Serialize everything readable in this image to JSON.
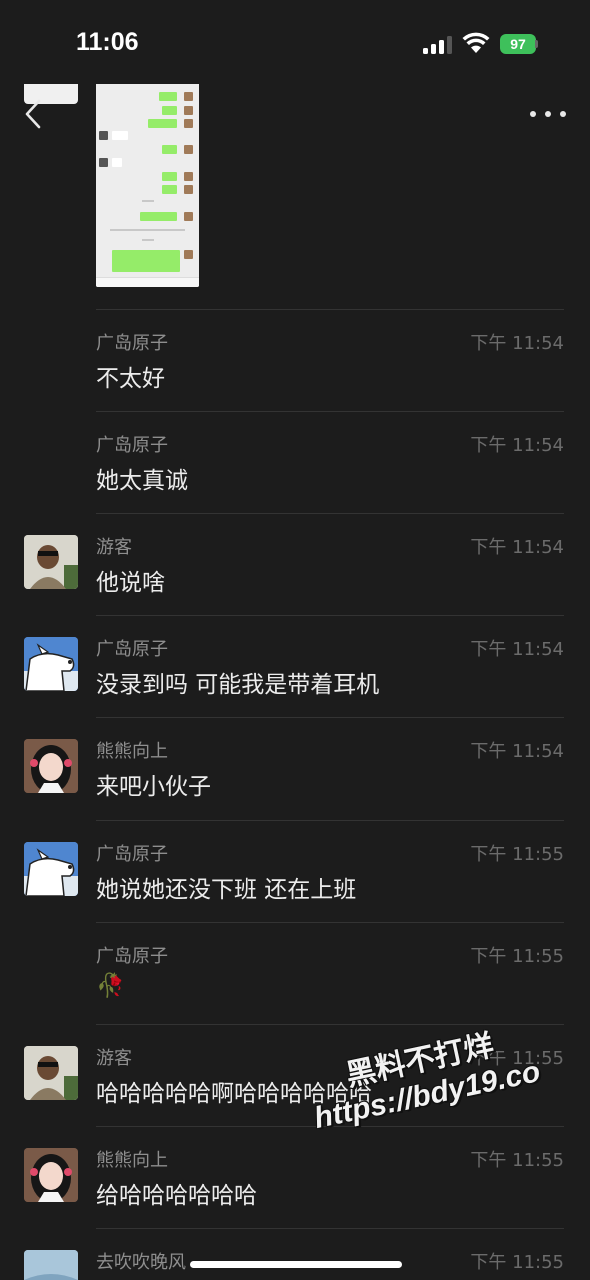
{
  "status_bar": {
    "time": "11:06",
    "battery": "97"
  },
  "header": {
    "back_icon": "chevron-left-icon",
    "more_icon": "ellipsis-icon"
  },
  "messages": [
    {
      "sender": "广岛原子",
      "time": "下午 11:54",
      "text": "不太好",
      "avatar": ""
    },
    {
      "sender": "广岛原子",
      "time": "下午 11:54",
      "text": "她太真诚",
      "avatar": ""
    },
    {
      "sender": "游客",
      "time": "下午 11:54",
      "text": "他说啥",
      "avatar": "guest"
    },
    {
      "sender": "广岛原子",
      "time": "下午 11:54",
      "text": "没录到吗 可能我是带着耳机",
      "avatar": "guangdao"
    },
    {
      "sender": "熊熊向上",
      "time": "下午 11:54",
      "text": "来吧小伙子",
      "avatar": "xiongxiong"
    },
    {
      "sender": "广岛原子",
      "time": "下午 11:55",
      "text": "她说她还没下班 还在上班",
      "avatar": "guangdao"
    },
    {
      "sender": "广岛原子",
      "time": "下午 11:55",
      "text": "🥀",
      "avatar": ""
    },
    {
      "sender": "游客",
      "time": "下午 11:55",
      "text": "哈哈哈哈哈啊哈哈哈哈哈哈",
      "avatar": "guest"
    },
    {
      "sender": "熊熊向上",
      "time": "下午 11:55",
      "text": "给哈哈哈哈哈哈",
      "avatar": "xiongxiong"
    },
    {
      "sender": "去吹吹晚风",
      "time": "下午 11:55",
      "text": "",
      "avatar": "wind"
    }
  ],
  "watermark": {
    "line1": "黑料不打烊",
    "line2": "https://bdy19.co"
  },
  "colors": {
    "background": "#1c1c1c",
    "bubble_green": "#95ec69",
    "battery_green": "#3ec05b"
  }
}
